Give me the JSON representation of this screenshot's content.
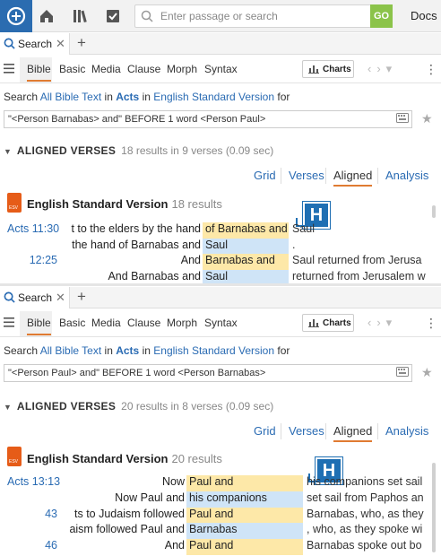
{
  "app": {
    "search_placeholder": "Enter passage or search",
    "go_label": "GO",
    "docs_label": "Docs"
  },
  "panels": [
    {
      "tab_label": "Search",
      "tab_close": "✕",
      "plus": "+",
      "tools": [
        "Bible",
        "Basic",
        "Media",
        "Clause",
        "Morph",
        "Syntax"
      ],
      "charts_label": "Charts",
      "search_in": {
        "prefix": "Search",
        "scope": "All Bible Text",
        "in": "in",
        "book": "Acts",
        "in2": "in",
        "version": "English Standard Version",
        "for": "for"
      },
      "query": "\"<Person Barnabas> and\" BEFORE 1 word  <Person Paul>",
      "section_title": "ALIGNED VERSES",
      "section_info": "18 results in 9 verses (0.09 sec)",
      "views": [
        "Grid",
        "Verses",
        "Aligned",
        "Analysis"
      ],
      "active_view": "Aligned",
      "resource_title": "English Standard Version",
      "resource_count": "18 results",
      "badge": "H",
      "rows": [
        {
          "ref": "Acts 11:30",
          "pre": "t to the elders by the hand",
          "a": "of Barnabas and",
          "b": "",
          "post": "Saul"
        },
        {
          "ref": "",
          "pre": "the hand of Barnabas and",
          "a": "",
          "b": "Saul",
          "post": "."
        },
        {
          "ref": "12:25",
          "pre": "And",
          "a": "Barnabas and",
          "b": "",
          "post": "Saul returned from Jerusa"
        },
        {
          "ref": "",
          "pre": "And Barnabas and",
          "a": "",
          "b": "Saul",
          "post": "returned from Jerusalem w"
        }
      ]
    },
    {
      "tab_label": "Search",
      "tab_close": "✕",
      "plus": "+",
      "tools": [
        "Bible",
        "Basic",
        "Media",
        "Clause",
        "Morph",
        "Syntax"
      ],
      "charts_label": "Charts",
      "search_in": {
        "prefix": "Search",
        "scope": "All Bible Text",
        "in": "in",
        "book": "Acts",
        "in2": "in",
        "version": "English Standard Version",
        "for": "for"
      },
      "query": "\"<Person Paul> and\" BEFORE 1 word  <Person Barnabas>",
      "section_title": "ALIGNED VERSES",
      "section_info": "20 results in 8 verses (0.09 sec)",
      "views": [
        "Grid",
        "Verses",
        "Aligned",
        "Analysis"
      ],
      "active_view": "Aligned",
      "resource_title": "English Standard Version",
      "resource_count": "20 results",
      "badge": "H",
      "rows": [
        {
          "ref": "Acts 13:13",
          "pre": "Now",
          "a": "Paul and",
          "b": "",
          "post": "his companions set sail"
        },
        {
          "ref": "",
          "pre": "Now Paul and",
          "a": "",
          "b": "his companions",
          "post": "set sail from Paphos an"
        },
        {
          "ref": "43",
          "pre": "ts to Judaism followed",
          "a": "Paul and",
          "b": "",
          "post": "Barnabas, who, as they"
        },
        {
          "ref": "",
          "pre": "aism followed Paul and",
          "a": "",
          "b": "Barnabas",
          "post": ", who, as they spoke wi"
        },
        {
          "ref": "46",
          "pre": "And",
          "a": "Paul and",
          "b": "",
          "post": "Barnabas spoke out bo"
        }
      ]
    }
  ]
}
